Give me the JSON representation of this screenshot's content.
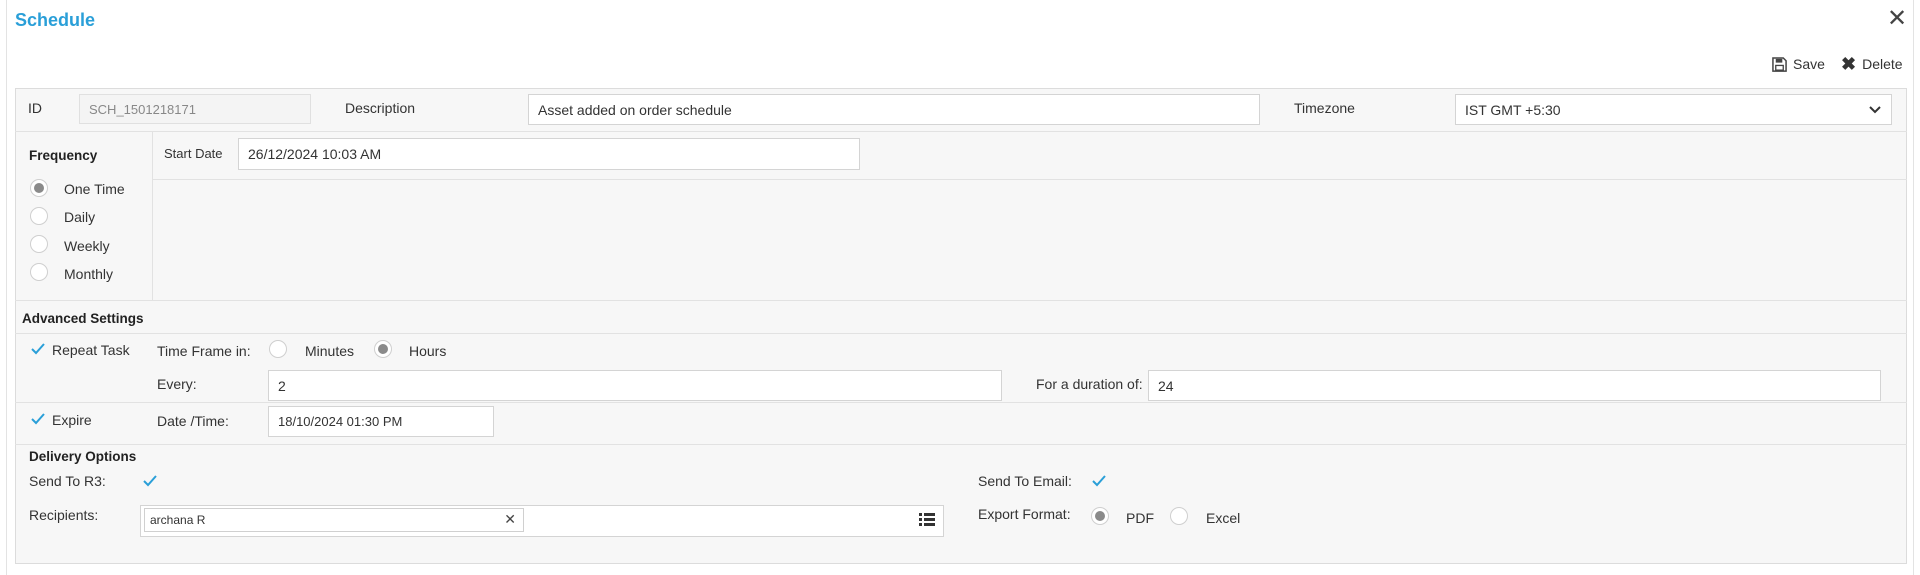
{
  "title": "Schedule",
  "toolbar": {
    "save_label": "Save",
    "delete_label": "Delete"
  },
  "general": {
    "id_label": "ID",
    "id_value": "SCH_1501218171",
    "description_label": "Description",
    "description_value": "Asset added on order schedule",
    "timezone_label": "Timezone",
    "timezone_value": "IST GMT +5:30"
  },
  "frequency": {
    "label": "Frequency",
    "options": [
      "One Time",
      "Daily",
      "Weekly",
      "Monthly"
    ],
    "selected": "One Time",
    "start_date_label": "Start Date",
    "start_date_value": "26/12/2024 10:03 AM"
  },
  "advanced": {
    "label": "Advanced Settings",
    "repeat_label": "Repeat Task",
    "repeat_checked": true,
    "timeframe_label": "Time Frame in:",
    "timeframe_options": [
      "Minutes",
      "Hours"
    ],
    "timeframe_selected": "Hours",
    "every_label": "Every:",
    "every_value": "2",
    "duration_label": "For a duration of:",
    "duration_value": "24",
    "expire_label": "Expire",
    "expire_checked": true,
    "datetime_label": "Date /Time:",
    "datetime_value": "18/10/2024 01:30 PM"
  },
  "delivery": {
    "label": "Delivery Options",
    "send_r3_label": "Send To R3:",
    "send_r3_checked": true,
    "send_email_label": "Send To Email:",
    "send_email_checked": true,
    "recipients_label": "Recipients:",
    "recipients": [
      "archana R"
    ],
    "export_label": "Export Format:",
    "export_options": [
      "PDF",
      "Excel"
    ],
    "export_selected": "PDF"
  },
  "colors": {
    "accent": "#2a9fd8",
    "check": "#2a9fd8",
    "radio_selected": "#8a8a8a"
  }
}
